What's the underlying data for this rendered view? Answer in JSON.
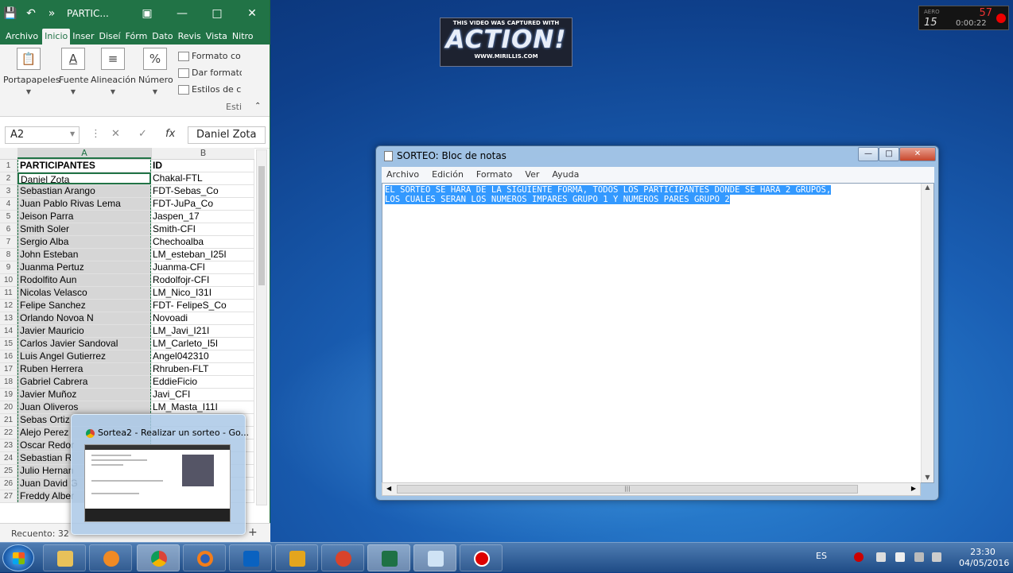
{
  "excel": {
    "title": "PARTIC...",
    "tabs": [
      "Archivo",
      "Inicio",
      "Inser",
      "Diseí",
      "Fórm",
      "Dato",
      "Revis",
      "Vista",
      "Nitro"
    ],
    "ribbon": {
      "groups": [
        "Portapapeles",
        "Fuente",
        "Alineación",
        "Número"
      ],
      "list": [
        "Formato co",
        "Dar formato",
        "Estilos de c"
      ],
      "section_label": "Esti"
    },
    "name_box": "A2",
    "formula_value": "Daniel Zota",
    "col_headers": [
      "A",
      "B"
    ],
    "rows": [
      {
        "n": "1",
        "a": "PARTICIPANTES",
        "b": "ID"
      },
      {
        "n": "2",
        "a": "Daniel Zota",
        "b": "Chakal-FTL"
      },
      {
        "n": "3",
        "a": "Sebastian Arango",
        "b": "FDT-Sebas_Co"
      },
      {
        "n": "4",
        "a": "Juan Pablo Rivas Lema",
        "b": "FDT-JuPa_Co"
      },
      {
        "n": "5",
        "a": "Jeison Parra",
        "b": "Jaspen_17"
      },
      {
        "n": "6",
        "a": "Smith Soler",
        "b": "Smith-CFI"
      },
      {
        "n": "7",
        "a": "Sergio Alba",
        "b": "Chechoalba"
      },
      {
        "n": "8",
        "a": "John Esteban",
        "b": "LM_esteban_I25I"
      },
      {
        "n": "9",
        "a": "Juanma Pertuz",
        "b": "Juanma-CFI"
      },
      {
        "n": "10",
        "a": "Rodolfito Aun",
        "b": "Rodolfojr-CFI"
      },
      {
        "n": "11",
        "a": "Nicolas Velasco",
        "b": "LM_Nico_I31I"
      },
      {
        "n": "12",
        "a": "Felipe Sanchez",
        "b": "FDT- FelipeS_Co"
      },
      {
        "n": "13",
        "a": "Orlando Novoa N",
        "b": "Novoadi"
      },
      {
        "n": "14",
        "a": "Javier Mauricio",
        "b": "LM_Javi_I21I"
      },
      {
        "n": "15",
        "a": "Carlos Javier Sandoval",
        "b": "LM_Carleto_I5I"
      },
      {
        "n": "16",
        "a": "Luis Angel Gutierrez",
        "b": "Angel042310"
      },
      {
        "n": "17",
        "a": "Ruben Herrera",
        "b": "Rhruben-FLT"
      },
      {
        "n": "18",
        "a": "Gabriel Cabrera",
        "b": "EddieFicio"
      },
      {
        "n": "19",
        "a": "Javier Muñoz",
        "b": "Javi_CFI"
      },
      {
        "n": "20",
        "a": "Juan Oliveros",
        "b": "LM_Masta_I11I"
      },
      {
        "n": "21",
        "a": "Sebas Ortiz",
        "b": ""
      },
      {
        "n": "22",
        "a": "Alejo Perez",
        "b": ""
      },
      {
        "n": "23",
        "a": "Oscar Redor",
        "b": ""
      },
      {
        "n": "24",
        "a": "Sebastian R",
        "b": ""
      },
      {
        "n": "25",
        "a": "Julio Hernan",
        "b": ""
      },
      {
        "n": "26",
        "a": "Juan David G",
        "b": ""
      },
      {
        "n": "27",
        "a": "Freddy Alber",
        "b": ""
      }
    ],
    "status": "Recuento: 32"
  },
  "thumbnail": {
    "title": "Sortea2 - Realizar un sorteo - Go..."
  },
  "banner": {
    "line1": "THIS VIDEO WAS CAPTURED WITH",
    "logo": "ACTION!",
    "line3": "WWW.MIRILLIS.COM"
  },
  "recorder": {
    "aero": "AERO",
    "count": "15",
    "fps": "57",
    "time": "0:00:22"
  },
  "notepad": {
    "title": "SORTEO: Bloc de notas",
    "menu": [
      "Archivo",
      "Edición",
      "Formato",
      "Ver",
      "Ayuda"
    ],
    "line1": "EL SORTEO SE HARA DE LA SIGUIENTE FORMA, TODOS LOS PARTICIPANTES DONDE SE HARA 2 GRUPOS,",
    "line2": "LOS CUALES SERAN LOS NUMEROS IMPARES GRUPO 1 Y NUMEROS PARES GRUPO 2"
  },
  "taskbar": {
    "lang": "ES",
    "time": "23:30",
    "date": "04/05/2016"
  }
}
